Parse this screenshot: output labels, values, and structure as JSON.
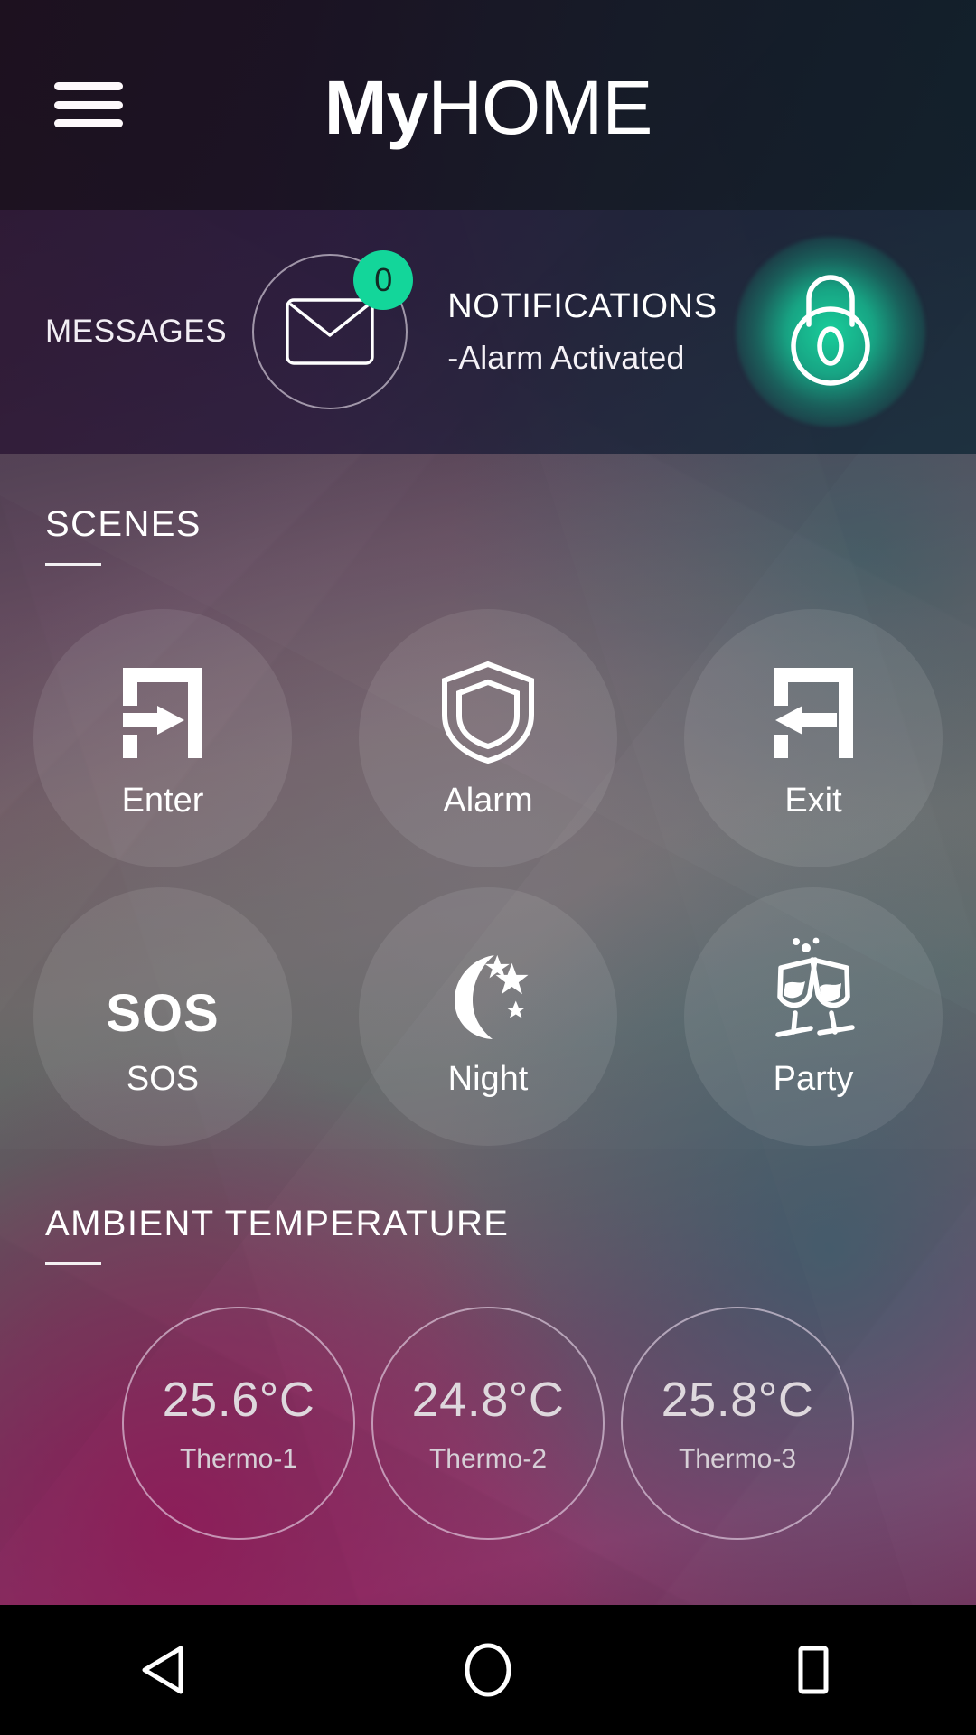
{
  "header": {
    "menu_icon": "hamburger-menu-icon",
    "brand_bold": "My",
    "brand_light": "HOME"
  },
  "notifications": {
    "messages_label": "MESSAGES",
    "messages_icon": "envelope-icon",
    "messages_badge_count": "0",
    "title": "NOTIFICATIONS",
    "message": "-Alarm Activated",
    "lock_icon": "padlock-icon",
    "lock_count": "0",
    "badge_color": "#13d69a",
    "glow_color": "#19d7a0"
  },
  "scenes": {
    "title": "SCENES",
    "items": [
      {
        "label": "Enter",
        "icon": "door-enter-icon"
      },
      {
        "label": "Alarm",
        "icon": "shield-icon"
      },
      {
        "label": "Exit",
        "icon": "door-exit-icon"
      },
      {
        "label": "SOS",
        "icon": "sos-text-icon",
        "glyph": "SOS"
      },
      {
        "label": "Night",
        "icon": "moon-stars-icon"
      },
      {
        "label": "Party",
        "icon": "champagne-glasses-icon"
      }
    ]
  },
  "ambient_temperature": {
    "title": "AMBIENT TEMPERATURE",
    "sensors": [
      {
        "value": "25.6°C",
        "name": "Thermo-1"
      },
      {
        "value": "24.8°C",
        "name": "Thermo-2"
      },
      {
        "value": "25.8°C",
        "name": "Thermo-3"
      }
    ]
  },
  "navbar": {
    "back_icon": "back-triangle-icon",
    "home_icon": "home-circle-icon",
    "recents_icon": "recents-square-icon"
  }
}
